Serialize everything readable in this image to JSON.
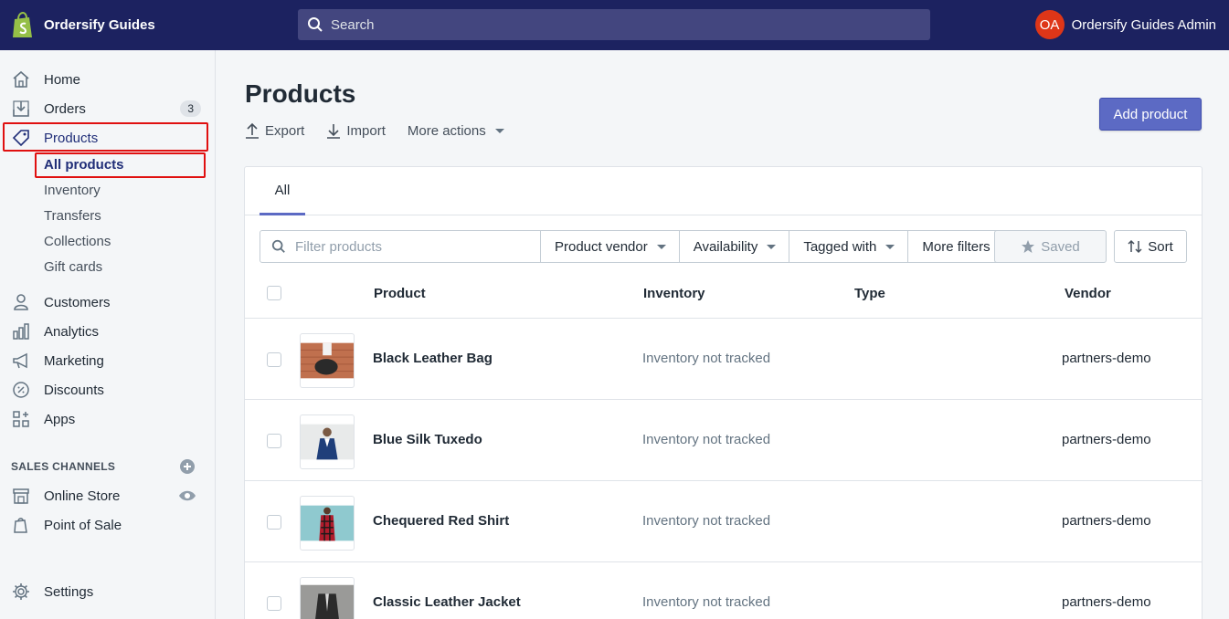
{
  "header": {
    "store_name": "Ordersify Guides",
    "search_placeholder": "Search",
    "user_initials": "OA",
    "user_name": "Ordersify Guides Admin",
    "avatar_color": "#de3618",
    "bar_color": "#1c2260"
  },
  "sidebar": {
    "items": [
      {
        "label": "Home",
        "icon": "home-icon"
      },
      {
        "label": "Orders",
        "icon": "orders-icon",
        "badge": "3"
      },
      {
        "label": "Products",
        "icon": "tag-icon"
      },
      {
        "label": "Customers",
        "icon": "customer-icon"
      },
      {
        "label": "Analytics",
        "icon": "analytics-icon"
      },
      {
        "label": "Marketing",
        "icon": "megaphone-icon"
      },
      {
        "label": "Discounts",
        "icon": "discount-icon"
      },
      {
        "label": "Apps",
        "icon": "apps-icon"
      }
    ],
    "products_sub": [
      "All products",
      "Inventory",
      "Transfers",
      "Collections",
      "Gift cards"
    ],
    "sales_channels_heading": "SALES CHANNELS",
    "channels": [
      {
        "label": "Online Store",
        "icon": "store-icon"
      },
      {
        "label": "Point of Sale",
        "icon": "pos-icon"
      }
    ],
    "settings_label": "Settings"
  },
  "main": {
    "title": "Products",
    "actions": {
      "export": "Export",
      "import": "Import",
      "more": "More actions"
    },
    "add_button": "Add product",
    "accent_color": "#5c6ac4",
    "tabs": [
      "All"
    ],
    "filter": {
      "placeholder": "Filter products",
      "buttons": [
        "Product vendor",
        "Availability",
        "Tagged with",
        "More filters"
      ],
      "saved": "Saved",
      "sort": "Sort"
    },
    "columns": [
      "Product",
      "Inventory",
      "Type",
      "Vendor"
    ],
    "rows": [
      {
        "name": "Black Leather Bag",
        "inventory": "Inventory not tracked",
        "type": "",
        "vendor": "partners-demo"
      },
      {
        "name": "Blue Silk Tuxedo",
        "inventory": "Inventory not tracked",
        "type": "",
        "vendor": "partners-demo"
      },
      {
        "name": "Chequered Red Shirt",
        "inventory": "Inventory not tracked",
        "type": "",
        "vendor": "partners-demo"
      },
      {
        "name": "Classic Leather Jacket",
        "inventory": "Inventory not tracked",
        "type": "",
        "vendor": "partners-demo"
      }
    ]
  }
}
